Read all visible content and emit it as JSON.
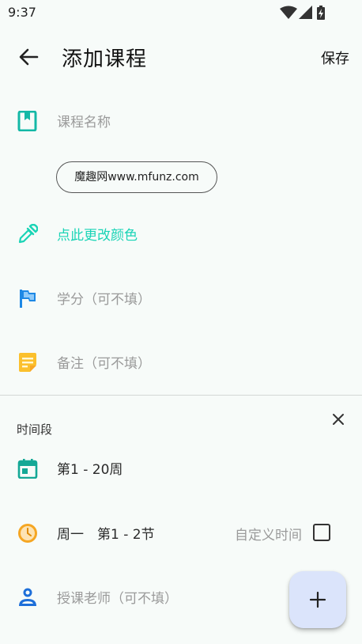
{
  "status_bar": {
    "time": "9:37",
    "icons": [
      "wifi-icon",
      "cell-signal-icon",
      "battery-charging-icon"
    ]
  },
  "app_bar": {
    "back_icon": "arrow-back-icon",
    "title": "添加课程",
    "save_label": "保存"
  },
  "form": {
    "course_name": {
      "icon": "book-icon",
      "placeholder": "课程名称",
      "color": "#14b8a6"
    },
    "watermark": "魔趣网www.mfunz.com",
    "color_picker": {
      "icon": "eyedropper-icon",
      "label": "点此更改颜色",
      "color": "#1ad4b6"
    },
    "credit": {
      "icon": "flag-icon",
      "placeholder": "学分（可不填）",
      "color": "#1e88e5"
    },
    "note": {
      "icon": "sticky-note-icon",
      "placeholder": "备注（可不填）",
      "color": "#fbc02d"
    }
  },
  "time_section": {
    "title": "时间段",
    "close_icon": "close-icon",
    "weeks": {
      "icon": "calendar-icon",
      "label": "第1 - 20周",
      "color": "#14a896"
    },
    "session": {
      "icon": "clock-icon",
      "label": "周一　第1 - 2节",
      "color": "#f5a623"
    },
    "custom_time": {
      "label": "自定义时间",
      "checked": false
    },
    "teacher": {
      "icon": "person-icon",
      "placeholder": "授课老师（可不填）",
      "color": "#1e6fd9"
    }
  },
  "fab": {
    "icon": "plus-icon",
    "color": "#dbe4fb"
  }
}
